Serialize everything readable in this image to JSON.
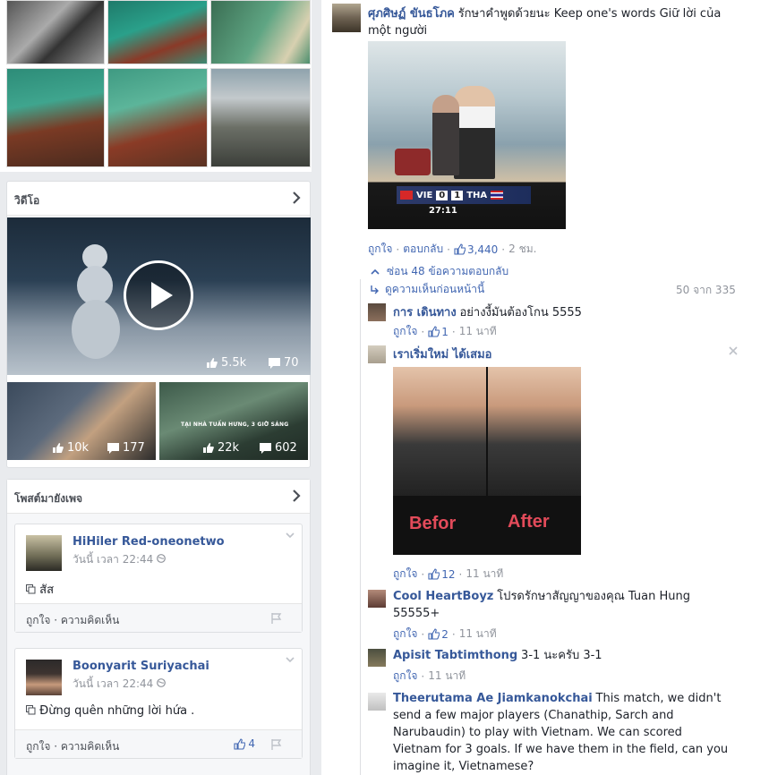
{
  "left": {
    "video_section": {
      "title": "วิดีโอ",
      "featured": {
        "likes": "5.5k",
        "comments": "70"
      },
      "thumbs": [
        {
          "likes": "10k",
          "comments": "177"
        },
        {
          "likes": "22k",
          "comments": "602",
          "caption": "TẠI NHÀ TUẤN HƯNG, 3 GIỜ SÁNG"
        }
      ]
    },
    "posts_section": {
      "title": "โพสต์มายังเพจ",
      "posts": [
        {
          "name": "HiHiler Red-oneonetwo",
          "time": "วันนี้ เวลา 22:44",
          "text": "สัส",
          "like": "ถูกใจ",
          "comment": "ความคิดเห็น",
          "count": ""
        },
        {
          "name": "Boonyarit Suriyachai",
          "time": "วันนี้ เวลา 22:44",
          "text": "Đừng quên những lời hứa .",
          "like": "ถูกใจ",
          "comment": "ความคิดเห็น",
          "count": "4"
        }
      ]
    }
  },
  "right": {
    "main_comment": {
      "name": "ศุภศิษฏ์ ขันธโภค",
      "text": "รักษาคำพูดด้วยนะ Keep one's words Giữ lời của một người",
      "like": "ถูกใจ",
      "reply": "ตอบกลับ",
      "likes": "3,440",
      "time": "2 ชม.",
      "image": {
        "score_left": "VIE",
        "score_a": "0",
        "score_b": "1",
        "score_right": "THA",
        "clock": "27:11"
      }
    },
    "hide_replies": "ซ่อน 48 ข้อความตอบกลับ",
    "prev_comments": "ดูความเห็นก่อนหน้านี้",
    "pager": "50 จาก 335",
    "replies": [
      {
        "name": "การ เดินทาง",
        "text": "อย่างงี้มันต้องโกน 5555",
        "like": "ถูกใจ",
        "likes": "1",
        "time": "11 นาที"
      },
      {
        "name": "เราเริ่มใหม่ ได้เสมอ",
        "text": "",
        "like": "ถูกใจ",
        "likes": "12",
        "time": "11 นาที",
        "image": {
          "before": "Befor",
          "after": "After"
        }
      },
      {
        "name": "Cool HeartBoyz",
        "text": "โปรดรักษาสัญญาของคุณ Tuan Hung 55555+",
        "like": "ถูกใจ",
        "likes": "2",
        "time": "11 นาที"
      },
      {
        "name": "Apisit Tabtimthong",
        "text": "3-1 นะครับ 3-1",
        "like": "ถูกใจ",
        "likes": "",
        "time": "11 นาที"
      },
      {
        "name": "Theerutama Ae Jiamkanokchai",
        "text": "This match, we didn't send a few major players (Chanathip, Sarch and Narubaudin) to play with Vietnam. We can scored Vietnam for 3 goals. If we have them in the field, can you imagine it, Vietnamese?"
      }
    ]
  },
  "colors": {
    "link": "#365899",
    "meta": "#90949c",
    "bg": "#e9ebee"
  }
}
